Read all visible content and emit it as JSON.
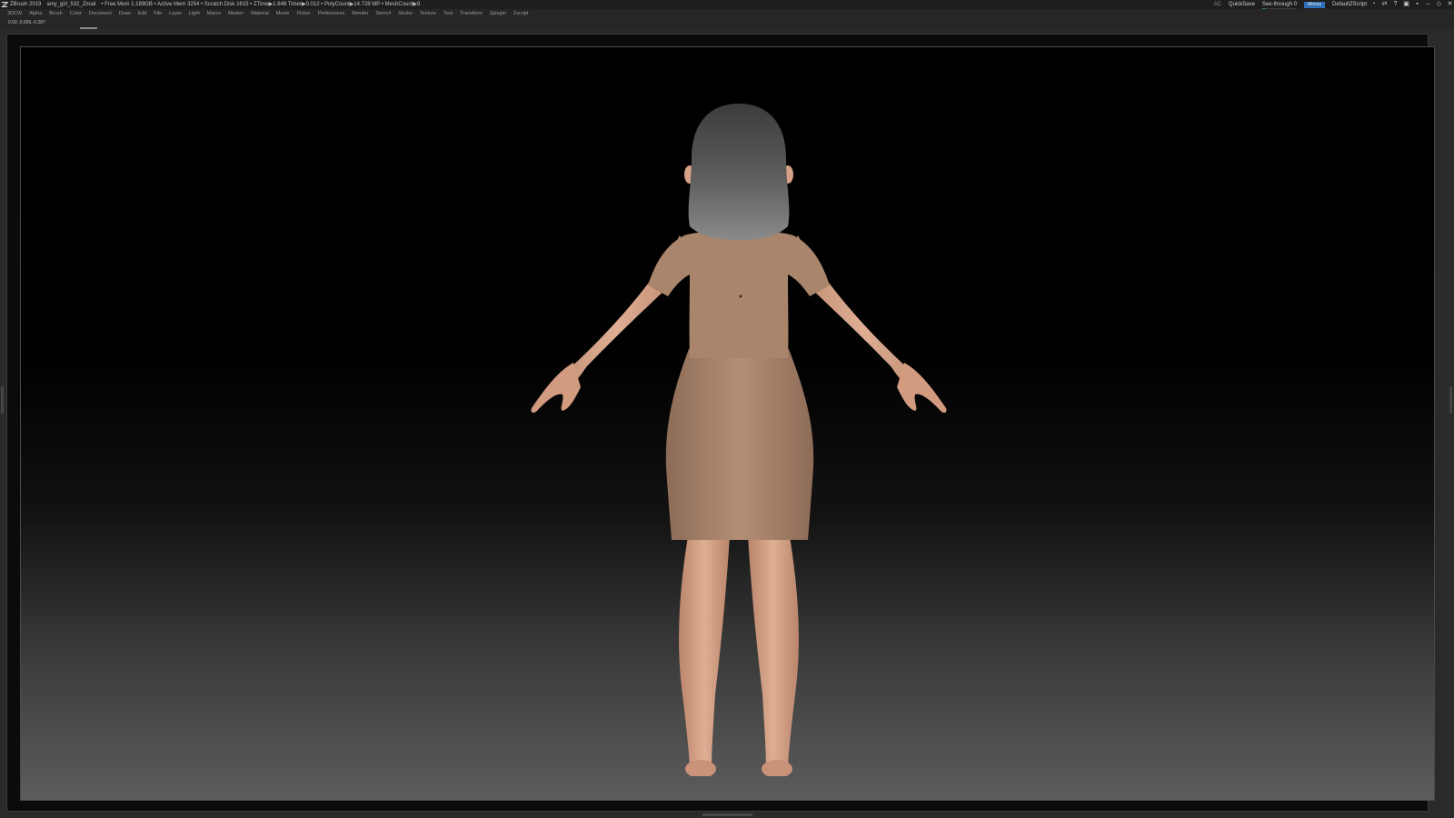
{
  "titlebar": {
    "app": "ZBrush 2019",
    "file": "amy_girl_532_Zmail",
    "stats": "• Free Mem 1.189GB • Active Mem 3254 • Scratch Disk 1615 • ZTime▶1.648 Timer▶0.012 • PolyCount▶14.728 MP • MeshCount▶9",
    "ac_label": "AC",
    "quicksave_label": "QuickSave",
    "seethrough_label": "See-through",
    "seethrough_value": "0",
    "menus_label": "Menus",
    "default_script_label": "DefaultZScript"
  },
  "menubar": {
    "items": [
      "3DCW",
      "Alpha",
      "Brush",
      "Color",
      "Document",
      "Draw",
      "Edit",
      "File",
      "Layer",
      "Light",
      "Macro",
      "Marker",
      "Material",
      "Movie",
      "Picker",
      "Preferences",
      "Render",
      "Stencil",
      "Stroke",
      "Texture",
      "Tool",
      "Transform",
      "Zplugin",
      "Zscript"
    ]
  },
  "coordinates": "0.02,-0.656,-0.287",
  "colors": {
    "skin": "#d9a488",
    "dress": "#a7826a",
    "hair": "#5c5c5c",
    "accent": "#2f6fb8",
    "seethrough_fill": "#2e8a3a"
  }
}
